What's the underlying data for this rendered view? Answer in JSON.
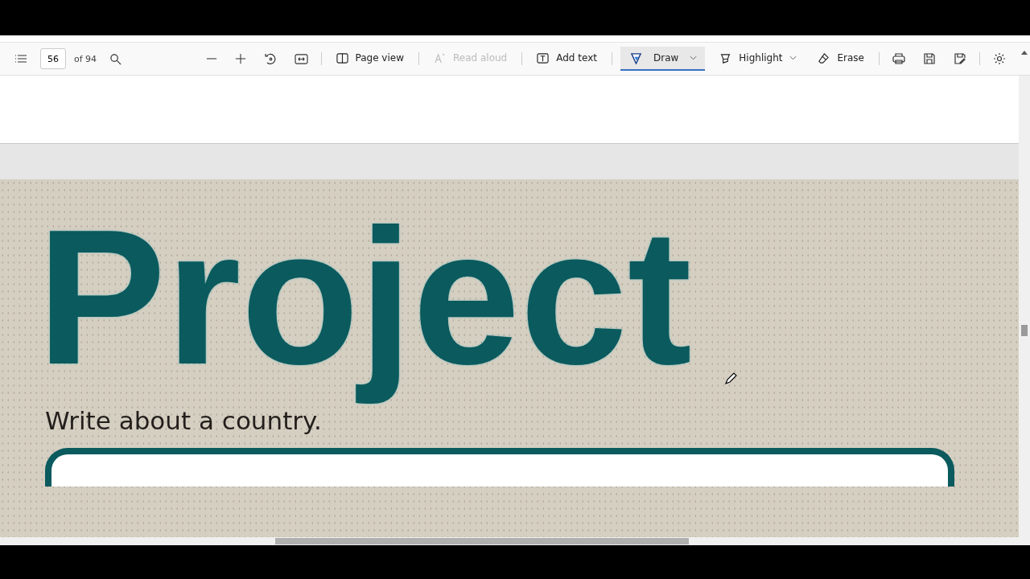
{
  "toolbar": {
    "page_number": "56",
    "page_count": "of 94",
    "tools": [
      {
        "label": "Page view",
        "disabled": false,
        "selected": false,
        "dropdown": false
      },
      {
        "label": "Read aloud",
        "disabled": true,
        "selected": false,
        "dropdown": false
      },
      {
        "label": "Add text",
        "disabled": false,
        "selected": false,
        "dropdown": false
      },
      {
        "label": "Draw",
        "disabled": false,
        "selected": true,
        "dropdown": true
      },
      {
        "label": "Highlight",
        "disabled": false,
        "selected": false,
        "dropdown": true
      },
      {
        "label": "Erase",
        "disabled": false,
        "selected": false,
        "dropdown": false
      }
    ]
  },
  "document": {
    "title": "Project",
    "subtitle": "Write about a country."
  }
}
